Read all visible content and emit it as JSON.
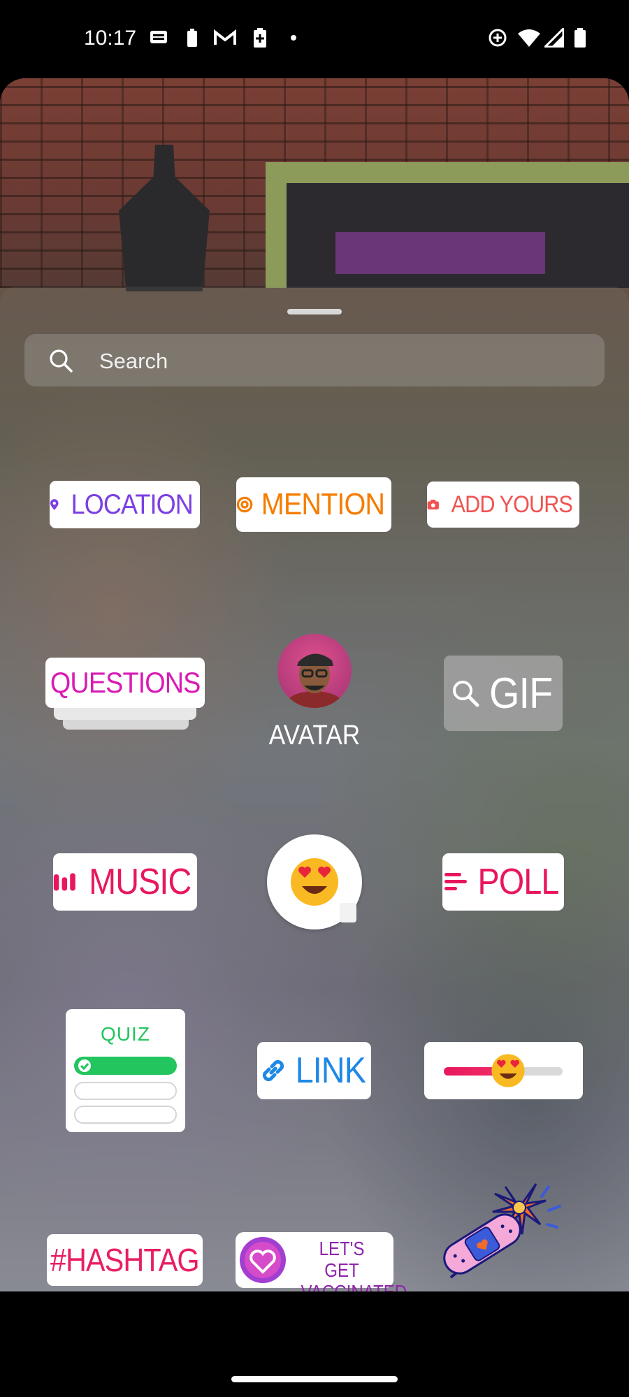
{
  "status_bar": {
    "time": "10:17"
  },
  "search": {
    "placeholder": "Search"
  },
  "stickers": {
    "location": "LOCATION",
    "mention": "MENTION",
    "add_yours": "ADD YOURS",
    "questions": "QUESTIONS",
    "avatar": "AVATAR",
    "gif": "GIF",
    "music": "MUSIC",
    "poll": "POLL",
    "quiz": "QUIZ",
    "link": "LINK",
    "hashtag": "#HASHTAG",
    "vaccinated_line1": "LET'S GET",
    "vaccinated_line2": "VACCINATED"
  },
  "colors": {
    "location": "#7b3fe4",
    "mention": "#f57c00",
    "add_yours": "#ef5350",
    "questions": "#d81bb4",
    "music": "#e8175d",
    "poll": "#e8175d",
    "quiz": "#22c55e",
    "link": "#1e88e5",
    "hashtag": "#e91e63",
    "vaccinated": "#8e24aa"
  }
}
